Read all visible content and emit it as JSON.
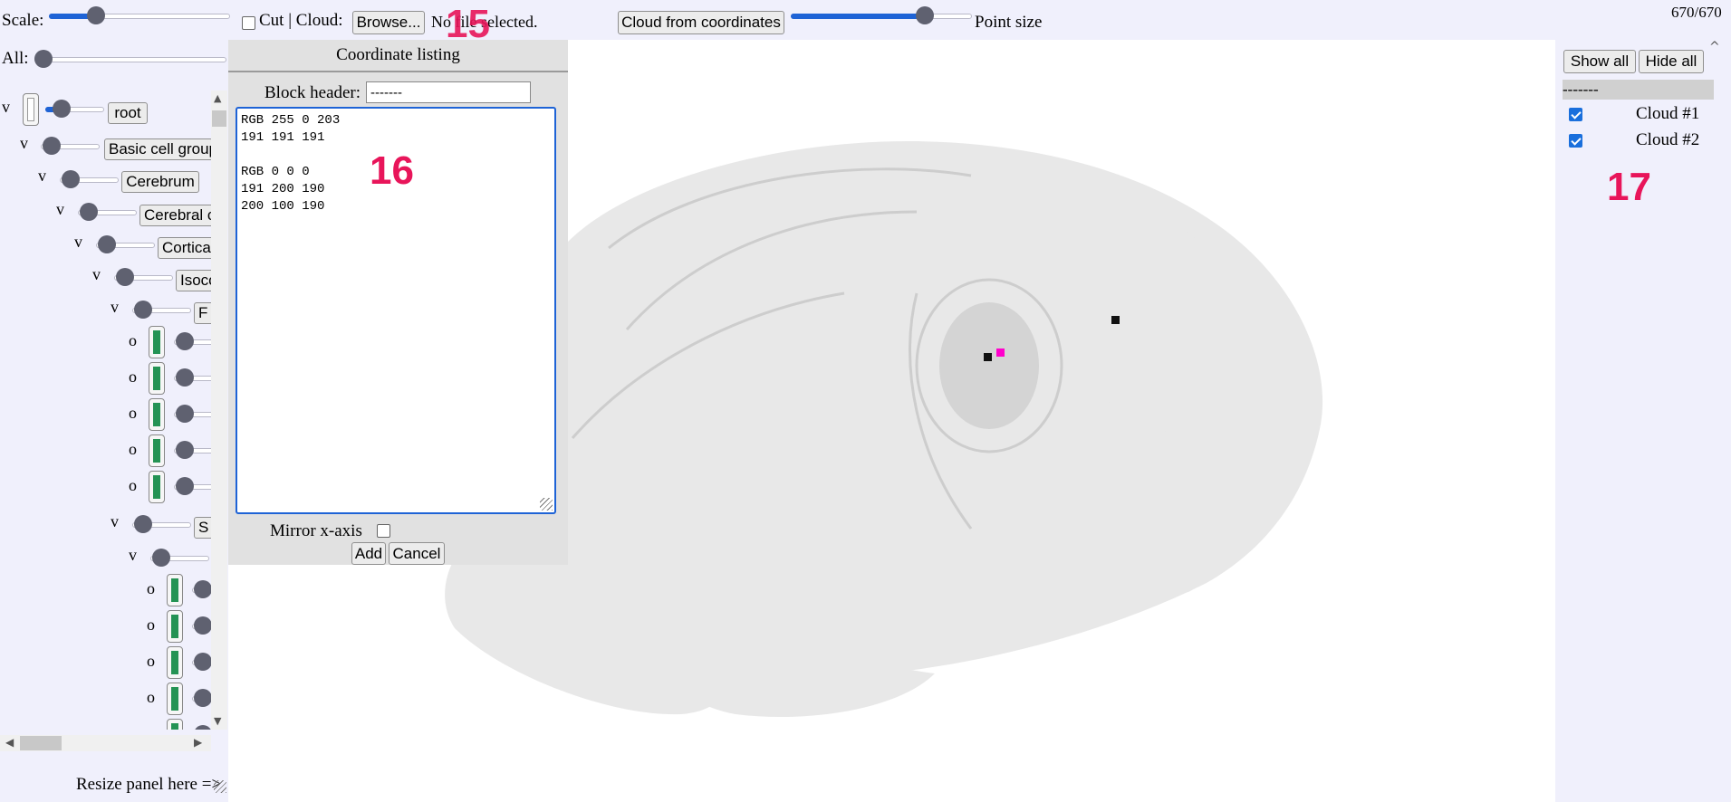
{
  "toolbar": {
    "scale_label": "Scale:",
    "scale_value": 0.27,
    "cut_label": "Cut | Cloud:",
    "browse_label": "Browse...",
    "file_status": "No file selected.",
    "cloud_from_coords_label": "Cloud from coordinates",
    "point_size_value": 0.75,
    "point_size_label": "Point size",
    "counter": "670/670"
  },
  "left_panel": {
    "all_label": "All:",
    "resize_label": "Resize panel here =>",
    "tree": [
      {
        "toggle": "v",
        "label": "root"
      },
      {
        "toggle": "v",
        "label": "Basic cell groups and regions"
      },
      {
        "toggle": "v",
        "label": "Cerebrum"
      },
      {
        "toggle": "v",
        "label": "Cerebral cortex"
      },
      {
        "toggle": "v",
        "label": "Cortical plate"
      },
      {
        "toggle": "v",
        "label": "Isocortex"
      },
      {
        "toggle": "v",
        "label": "F"
      },
      {
        "toggle": "o"
      },
      {
        "toggle": "o"
      },
      {
        "toggle": "o"
      },
      {
        "toggle": "o"
      },
      {
        "toggle": "o"
      },
      {
        "toggle": "v",
        "label": "S"
      },
      {
        "toggle": "v"
      },
      {
        "toggle": "o"
      },
      {
        "toggle": "o"
      },
      {
        "toggle": "o"
      },
      {
        "toggle": "o"
      },
      {
        "toggle": "o"
      }
    ]
  },
  "dialog": {
    "title": "Coordinate listing",
    "block_header_label": "Block header:",
    "block_header_value": "-------",
    "textarea_value": "RGB 255 0 203\n191 191 191\n\nRGB 0 0 0\n191 200 190\n200 100 190",
    "mirror_label": "Mirror x-axis",
    "add_label": "Add",
    "cancel_label": "Cancel"
  },
  "right_panel": {
    "show_all_label": "Show all",
    "hide_all_label": "Hide all",
    "group_header": "-------",
    "clouds": [
      {
        "label": "Cloud #1",
        "checked": true
      },
      {
        "label": "Cloud #2",
        "checked": true
      }
    ]
  },
  "annotations": {
    "a15": "15",
    "a16": "16",
    "a17": "17"
  },
  "colors": {
    "accent": "#1e63d6",
    "swatch_green": "#249354",
    "point_magenta": "#ff00cc",
    "point_black": "#111111",
    "annotation_red": "#e8155a"
  }
}
